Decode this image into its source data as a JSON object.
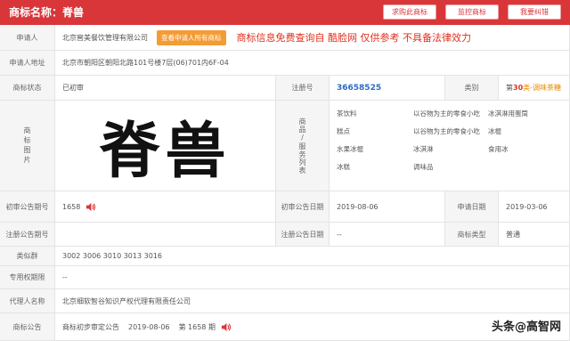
{
  "header": {
    "title": "商标名称：脊兽",
    "buttons": [
      "求购此商标",
      "监控商标",
      "我要纠错"
    ]
  },
  "applicant": {
    "label": "申请人",
    "value": "北京窖美餐饮管理有限公司",
    "view_all_button": "查看申请人所有商标",
    "disclaimer": "商标信息免费查询自 酷脸网 仅供参考 不具备法律效力"
  },
  "address": {
    "label": "申请人地址",
    "value": "北京市朝阳区朝阳北路101号楼7层(06)701内6F-04"
  },
  "status": {
    "label": "商标状态",
    "value": "已初审",
    "reg_label": "注册号",
    "reg_value": "36658525",
    "class_label": "类别",
    "class_prefix": "第",
    "class_num": "30",
    "class_suffix": "类-",
    "class_name": "调味茶糖"
  },
  "image": {
    "label": "商标图片",
    "logo_text": "脊兽",
    "goods_label": "商品/服务列表",
    "goods": [
      [
        "茶饮料",
        "以谷物为主的零食小吃",
        "冰淇淋用蛋筒"
      ],
      [
        "糕点",
        "以谷物为主的零食小吃",
        "冰棍"
      ],
      [
        "水果冰棍",
        "冰淇淋",
        "食用冰"
      ],
      [
        "冰糕",
        "调味品",
        ""
      ]
    ]
  },
  "prelim": {
    "label": "初审公告期号",
    "value": "1658",
    "date_label": "初审公告日期",
    "date_value": "2019-08-06",
    "apply_label": "申请日期",
    "apply_value": "2019-03-06"
  },
  "reg_notice": {
    "label": "注册公告期号",
    "value": "",
    "date_label": "注册公告日期",
    "date_value": "--",
    "type_label": "商标类型",
    "type_value": "普通"
  },
  "similar": {
    "label": "类似群",
    "value": "3002 3006 3010 3013 3016"
  },
  "exclusive": {
    "label": "专用权期限",
    "value": "--"
  },
  "agent": {
    "label": "代理人名称",
    "value": "北京细软智谷知识产权代理有限责任公司"
  },
  "announce": {
    "label": "商标公告",
    "type": "商标初步审定公告",
    "date": "2019-08-06",
    "issue": "第 1658 期"
  },
  "watermark": "头条@高智网"
}
